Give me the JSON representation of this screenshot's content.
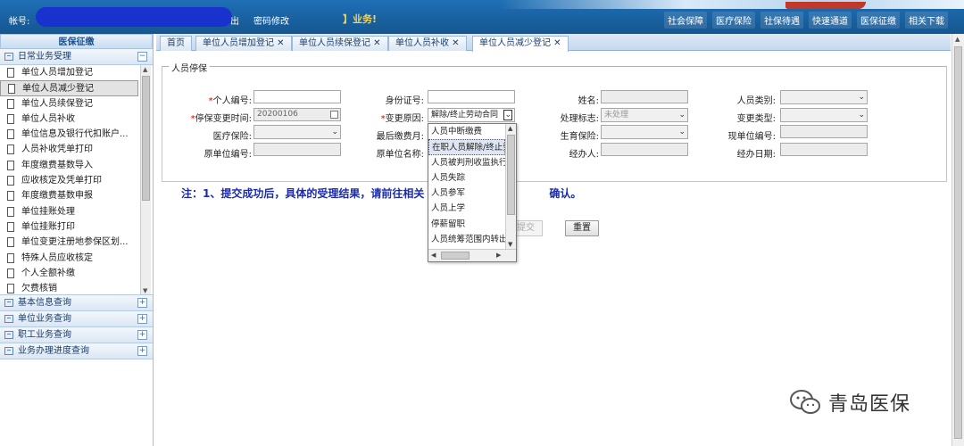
{
  "topbar": {
    "account_label": "帐号:",
    "exit_label": "出",
    "pwd_label": "密码修改",
    "biz_tag": "】业务!",
    "nav": [
      "社会保障",
      "医疗保险",
      "社保待遇",
      "快速通道",
      "医保征缴",
      "相关下载"
    ]
  },
  "sidebar": {
    "title": "医保征缴",
    "group_daily": "日常业务受理",
    "items": [
      "单位人员增加登记",
      "单位人员减少登记",
      "单位人员续保登记",
      "单位人员补收",
      "单位信息及银行代扣账户...",
      "人员补收凭单打印",
      "年度缴费基数导入",
      "应收核定及凭单打印",
      "年度缴费基数申报",
      "单位挂账处理",
      "单位挂账打印",
      "单位变更注册地参保区划...",
      "特殊人员应收核定",
      "个人全额补缴",
      "欠费核销"
    ],
    "groups": [
      "基本信息查询",
      "单位业务查询",
      "职工业务查询",
      "业务办理进度查询"
    ],
    "toggle_minus": "−",
    "toggle_plus": "+"
  },
  "tabs": [
    "首页",
    "单位人员增加登记 ✕",
    "单位人员续保登记 ✕",
    "单位人员补收 ✕",
    "单位人员减少登记 ✕"
  ],
  "form": {
    "legend": "人员停保",
    "labels": {
      "personal_no": "个人编号:",
      "id_no": "身份证号:",
      "name": "姓名:",
      "person_type": "人员类别:",
      "stop_date": "停保变更时间:",
      "change_reason": "变更原因:",
      "process_flag": "处理标志:",
      "change_type": "变更类型:",
      "medical": "医疗保险:",
      "last_month": "最后缴费月:",
      "maternity": "生育保险:",
      "new_unit_no": "现单位编号:",
      "orig_unit_no": "原单位编号:",
      "orig_unit_name": "原单位名称:",
      "handler": "经办人:",
      "handle_date": "经办日期:"
    },
    "req_mark": "*",
    "values": {
      "stop_date": "20200106",
      "change_reason": "解除/终止劳动合同",
      "process_flag": "未处理"
    }
  },
  "dropdown_options": [
    "人员中断缴费",
    "在职人员解除/终止劳",
    "人员被判刑收监执行",
    "人员失踪",
    "人员参军",
    "人员上学",
    "停薪留职",
    "人员统筹范围内转出"
  ],
  "note_left": "注：1、提交成功后，具体的受理结果，请前往相关",
  "note_right": "确认。",
  "buttons": {
    "submit": "提交",
    "reset": "重置"
  },
  "watermark": "青岛医保",
  "colors": {
    "topbar": "#1f6fb6",
    "note": "#1a2bb0",
    "required": "#d40000"
  }
}
